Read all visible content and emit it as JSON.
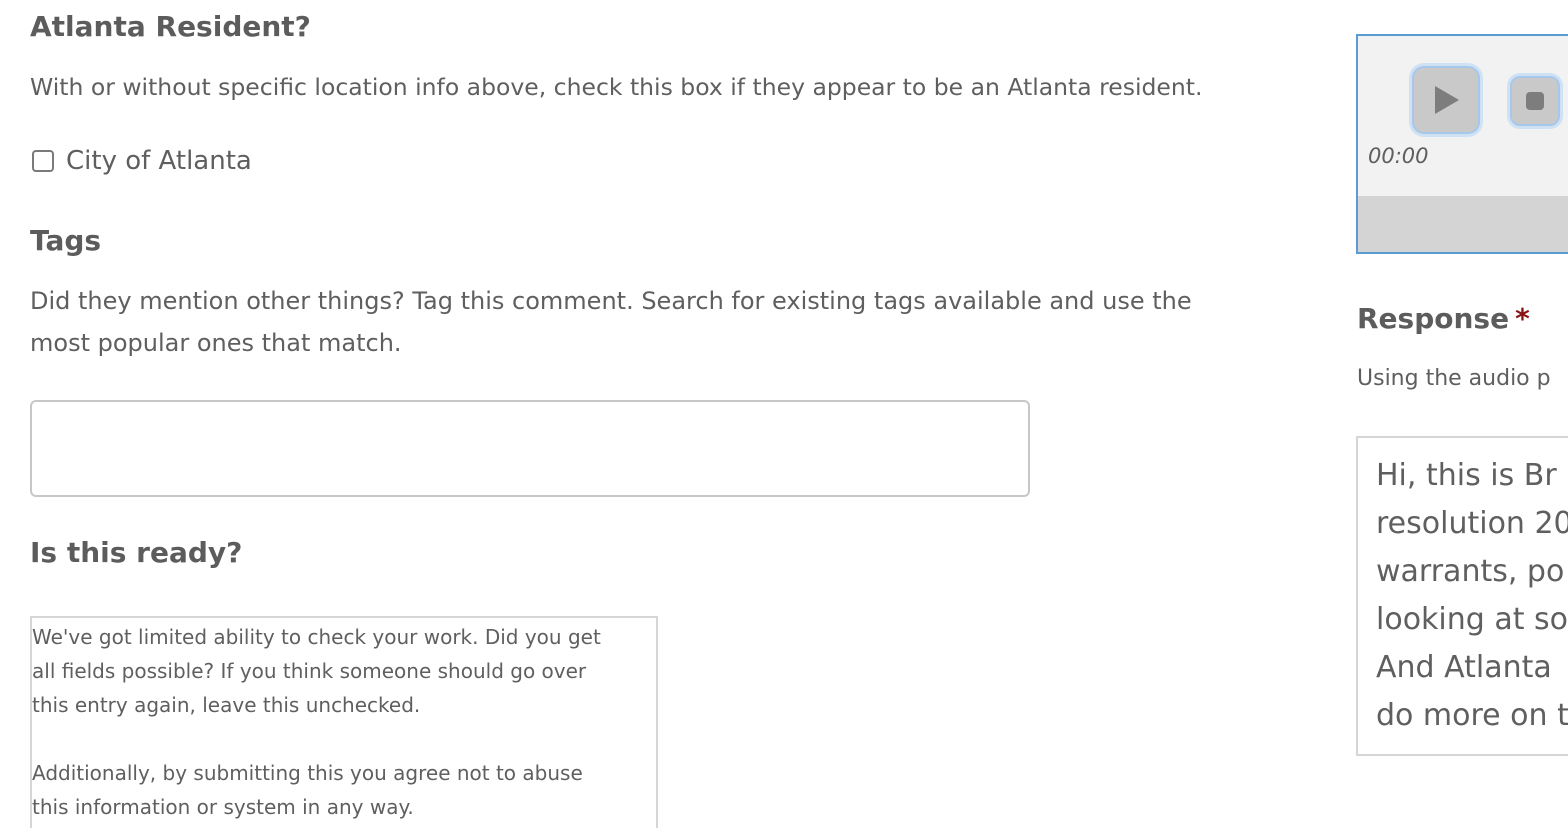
{
  "atlanta_resident": {
    "heading": "Atlanta Resident?",
    "description": "With or without specific location info above, check this box if they appear to be an Atlanta resident.",
    "checkbox_label": "City of Atlanta",
    "checked": false
  },
  "tags": {
    "heading": "Tags",
    "description_line1": "Did they mention other things? Tag this comment. Search for existing tags available and use the",
    "description_line2": "most popular ones that match.",
    "input_value": ""
  },
  "ready": {
    "heading": "Is this ready?",
    "paragraph1_line1": "We've got limited ability to check your work. Did you get",
    "paragraph1_line2": "all fields possible? If you think someone should go over",
    "paragraph1_line3": "this entry again, leave this unchecked.",
    "paragraph2_line1": "Additionally, by submitting this you agree not to abuse",
    "paragraph2_line2": "this information or system in any way."
  },
  "audio_player": {
    "time": "00:00",
    "play_icon": "play-icon",
    "stop_icon": "stop-icon"
  },
  "response": {
    "heading": "Response",
    "required_marker": "*",
    "description": "Using the audio p",
    "text_lines": [
      "Hi, this is Br",
      "resolution 20",
      "warrants, po",
      "looking at so",
      "And Atlanta",
      "do more on t"
    ]
  }
}
